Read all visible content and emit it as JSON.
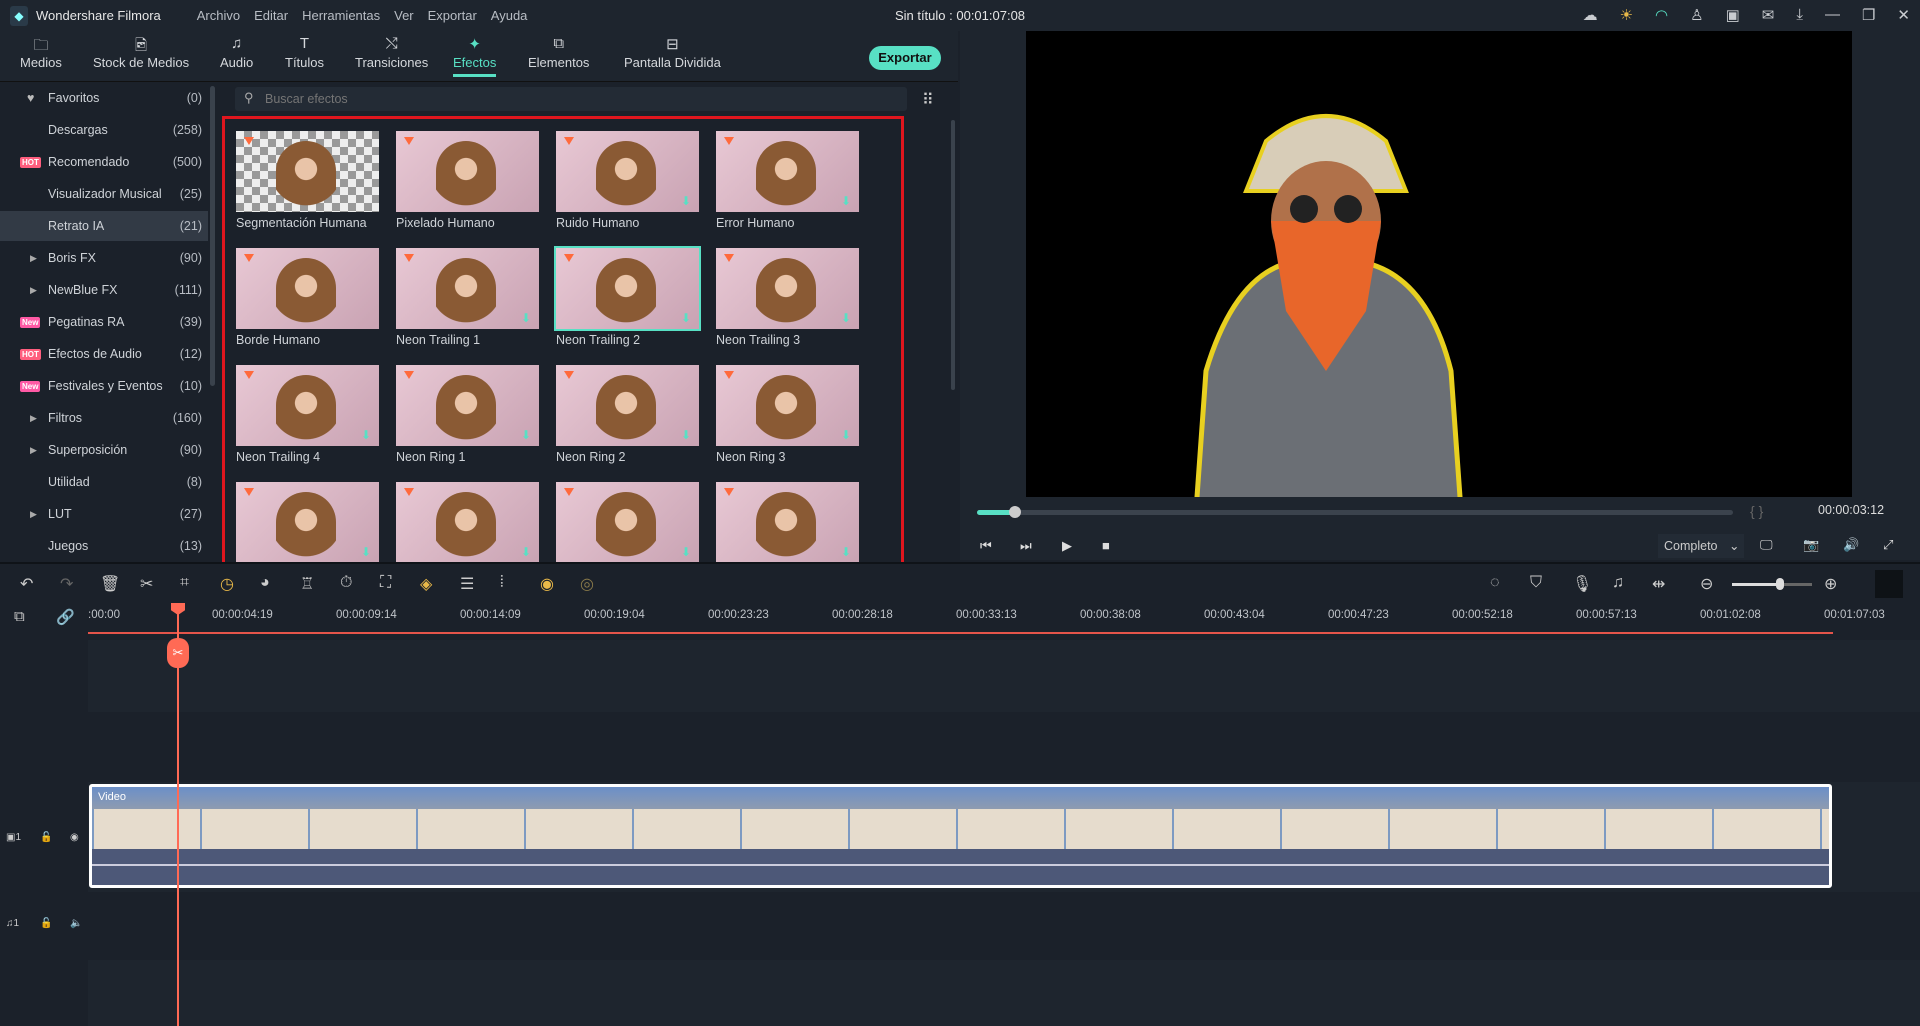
{
  "app": {
    "name": "Wondershare Filmora",
    "doc_title": "Sin título : 00:01:07:08",
    "menu": [
      "Archivo",
      "Editar",
      "Herramientas",
      "Ver",
      "Exportar",
      "Ayuda"
    ]
  },
  "tabs": [
    {
      "label": "Medios",
      "icon": "folder-icon"
    },
    {
      "label": "Stock de Medios",
      "icon": "stock-icon"
    },
    {
      "label": "Audio",
      "icon": "music-icon"
    },
    {
      "label": "Títulos",
      "icon": "text-icon"
    },
    {
      "label": "Transiciones",
      "icon": "transition-icon"
    },
    {
      "label": "Efectos",
      "icon": "effects-icon",
      "active": true
    },
    {
      "label": "Elementos",
      "icon": "elements-icon"
    },
    {
      "label": "Pantalla Dividida",
      "icon": "split-screen-icon"
    }
  ],
  "export_label": "Exportar",
  "sidebar": [
    {
      "label": "Favoritos",
      "count": "(0)",
      "icon": "heart-icon"
    },
    {
      "label": "Descargas",
      "count": "(258)"
    },
    {
      "label": "Recomendado",
      "count": "(500)",
      "badge": "HOT"
    },
    {
      "label": "Visualizador Musical",
      "count": "(25)"
    },
    {
      "label": "Retrato IA",
      "count": "(21)",
      "selected": true
    },
    {
      "label": "Boris FX",
      "count": "(90)",
      "expand": true
    },
    {
      "label": "NewBlue FX",
      "count": "(111)",
      "expand": true
    },
    {
      "label": "Pegatinas RA",
      "count": "(39)",
      "badge": "New"
    },
    {
      "label": "Efectos de Audio",
      "count": "(12)",
      "badge": "HOT"
    },
    {
      "label": "Festivales y Eventos",
      "count": "(10)",
      "badge": "New"
    },
    {
      "label": "Filtros",
      "count": "(160)",
      "expand": true
    },
    {
      "label": "Superposición",
      "count": "(90)",
      "expand": true
    },
    {
      "label": "Utilidad",
      "count": "(8)"
    },
    {
      "label": "LUT",
      "count": "(27)",
      "expand": true
    },
    {
      "label": "Juegos",
      "count": "(13)"
    }
  ],
  "search": {
    "placeholder": "Buscar efectos"
  },
  "effects": [
    "Segmentación Humana",
    "Pixelado Humano",
    "Ruido Humano",
    "Error Humano",
    "Borde Humano",
    "Neon Trailing 1",
    "Neon Trailing 2",
    "Neon Trailing 3",
    "Neon Trailing 4",
    "Neon Ring 1",
    "Neon Ring 2",
    "Neon Ring 3",
    "",
    "",
    "",
    ""
  ],
  "selected_effect": "Neon Trailing 2",
  "player": {
    "timecode": "00:00:03:12",
    "progress_fraction": 0.05,
    "quality": "Completo",
    "brackets": "{   }"
  },
  "timeline": {
    "ticks": [
      ":00:00",
      "00:00:04:19",
      "00:00:09:14",
      "00:00:14:09",
      "00:00:19:04",
      "00:00:23:23",
      "00:00:28:18",
      "00:00:33:13",
      "00:00:38:08",
      "00:00:43:04",
      "00:00:47:23",
      "00:00:52:18",
      "00:00:57:13",
      "00:01:02:08",
      "00:01:07:03"
    ],
    "clip_label": "Video",
    "video_track": "1",
    "audio_track": "1",
    "zoom_fraction": 0.55
  },
  "accent": "#58e0c4",
  "highlight_box": "#e0161e"
}
